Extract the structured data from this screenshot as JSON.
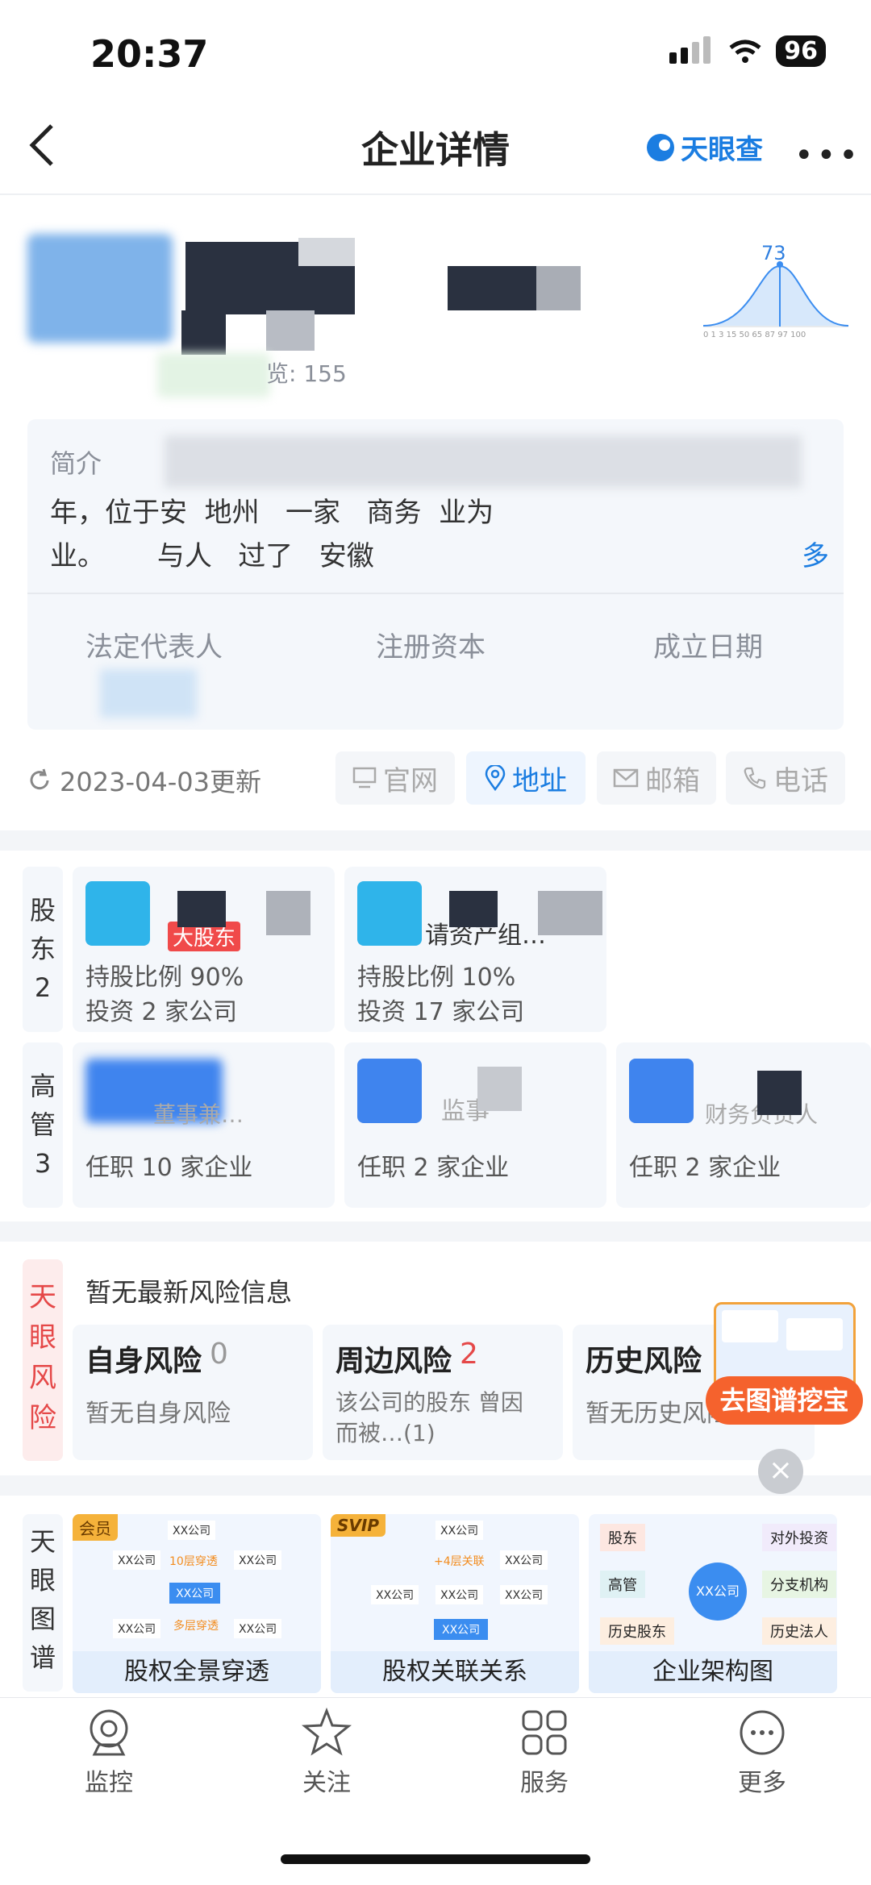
{
  "status": {
    "time": "20:37",
    "battery": "96"
  },
  "nav": {
    "title": "企业详情",
    "brand": "天眼查"
  },
  "company": {
    "browse": "览: 155",
    "score": "73",
    "chart_ticks": "0 1 3 15 50 65 87 97 100"
  },
  "intro": {
    "label": "简介",
    "line2": "年，位于安  地州   一家   商务  业为",
    "line3": "业。      与人   过了   安徽",
    "more": "多"
  },
  "keyinfo": {
    "legal_rep": "法定代表人",
    "capital": "注册资本",
    "date": "成立日期"
  },
  "update": {
    "text": "2023-04-03更新",
    "site": "官网",
    "address": "地址",
    "email": "邮箱",
    "phone": "电话"
  },
  "shareholders": {
    "label": "股东2",
    "items": [
      {
        "tag": "大股东",
        "ratio": "持股比例 90%",
        "invest": "投资 2 家公司"
      },
      {
        "name": "请资产组…",
        "ratio": "持股比例 10%",
        "invest": "投资 17 家公司"
      }
    ]
  },
  "executives": {
    "label": "高管3",
    "items": [
      {
        "role": "董事兼…",
        "serve": "任职 10 家企业"
      },
      {
        "role": "监事",
        "serve": "任职 2 家企业"
      },
      {
        "role": "财务负责人",
        "serve": "任职 2 家企业"
      }
    ]
  },
  "risk": {
    "side": "天眼风险",
    "header": "暂无最新风险信息",
    "cards": [
      {
        "title": "自身风险",
        "count": "0",
        "desc": "暂无自身风险"
      },
      {
        "title": "周边风险",
        "count": "2",
        "desc": "该公司的股东 曾因 而被…(1)"
      },
      {
        "title": "历史风险",
        "count": "",
        "desc": "暂无历史风险"
      }
    ],
    "promo": "去图谱挖宝"
  },
  "graph": {
    "side": "天眼图谱",
    "cards": [
      {
        "badge": "会员",
        "title": "股权全景穿透",
        "node": "XX公司",
        "mid1": "10层穿透",
        "mid2": "多层穿透"
      },
      {
        "badge": "SVIP",
        "title": "股权关联关系",
        "node": "XX公司",
        "mid1": "+4层关联"
      },
      {
        "title": "企业架构图",
        "center": "XX公司",
        "n1": "股东",
        "n2": "高管",
        "n3": "历史股东",
        "n4": "对外投资",
        "n5": "分支机构",
        "n6": "历史法人"
      }
    ]
  },
  "tabbar": [
    {
      "label": "监控",
      "icon": "monitor-icon"
    },
    {
      "label": "关注",
      "icon": "star-icon"
    },
    {
      "label": "服务",
      "icon": "grid-icon"
    },
    {
      "label": "更多",
      "icon": "more-icon"
    }
  ]
}
